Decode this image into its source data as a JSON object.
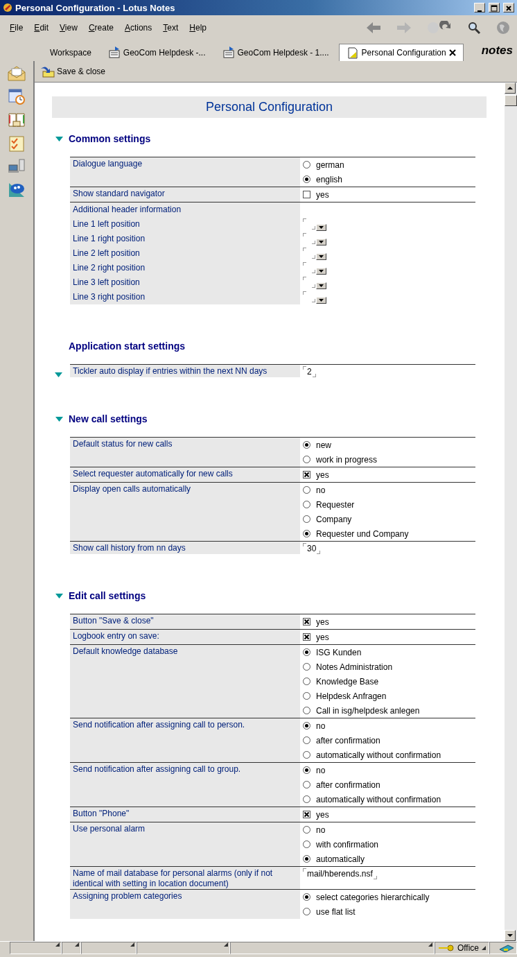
{
  "window": {
    "title": "Personal Configuration - Lotus Notes"
  },
  "menu": [
    "File",
    "Edit",
    "View",
    "Create",
    "Actions",
    "Text",
    "Help"
  ],
  "tabs": [
    {
      "label": "Workspace",
      "selected": false,
      "kind": "plain"
    },
    {
      "label": "GeoCom Helpdesk -...",
      "selected": false,
      "kind": "db"
    },
    {
      "label": "GeoCom Helpdesk -  1....",
      "selected": false,
      "kind": "db"
    },
    {
      "label": "Personal Configuration",
      "selected": true,
      "kind": "doc"
    }
  ],
  "brand": "notes",
  "toolbar": {
    "button": "Save & close"
  },
  "form": {
    "heading": "Personal Configuration",
    "sections": [
      {
        "title": "Common settings",
        "kind": "twistie",
        "rows": [
          {
            "label": "Dialogue language",
            "kind": "radio",
            "options": [
              {
                "label": "german",
                "selected": false
              },
              {
                "label": "english",
                "selected": true
              }
            ]
          },
          {
            "label": "Show standard navigator",
            "kind": "checkbox",
            "options": [
              {
                "label": "yes",
                "checked": false
              }
            ]
          },
          {
            "label": "Additional header information",
            "kind": "label"
          },
          {
            "label": "Line 1 left position",
            "kind": "dropdown"
          },
          {
            "label": "Line 1 right position",
            "kind": "dropdown"
          },
          {
            "label": "Line 2 left position",
            "kind": "dropdown"
          },
          {
            "label": "Line 2 right position",
            "kind": "dropdown"
          },
          {
            "label": "Line 3 left position",
            "kind": "dropdown"
          },
          {
            "label": "Line 3 right position",
            "kind": "dropdown"
          }
        ]
      },
      {
        "title": "Application start settings",
        "kind": "row-twistie",
        "rows": [
          {
            "label": "Tickler auto display if entries within the next NN days",
            "kind": "text",
            "value": "2"
          }
        ]
      },
      {
        "title": "New call settings",
        "kind": "twistie",
        "rows": [
          {
            "label": "Default status for new calls",
            "kind": "radio",
            "options": [
              {
                "label": "new",
                "selected": true
              },
              {
                "label": "work in progress",
                "selected": false
              }
            ]
          },
          {
            "label": "Select requester automatically for new calls",
            "kind": "checkbox",
            "options": [
              {
                "label": "yes",
                "checked": true
              }
            ]
          },
          {
            "label": "Display open calls automatically",
            "kind": "radio",
            "options": [
              {
                "label": "no",
                "selected": false
              },
              {
                "label": "Requester",
                "selected": false
              },
              {
                "label": "Company",
                "selected": false
              },
              {
                "label": "Requester und Company",
                "selected": true
              }
            ]
          },
          {
            "label": "Show call history from nn days",
            "kind": "text",
            "value": "30"
          }
        ]
      },
      {
        "title": "Edit call settings",
        "kind": "twistie",
        "rows": [
          {
            "label": "Button \"Save & close\"",
            "kind": "checkbox",
            "options": [
              {
                "label": "yes",
                "checked": true
              }
            ]
          },
          {
            "label": "Logbook entry on save:",
            "kind": "checkbox",
            "options": [
              {
                "label": "yes",
                "checked": true
              }
            ]
          },
          {
            "label": "Default knowledge database",
            "kind": "radio",
            "options": [
              {
                "label": "ISG Kunden",
                "selected": true
              },
              {
                "label": "Notes Administration",
                "selected": false
              },
              {
                "label": "Knowledge Base",
                "selected": false
              },
              {
                "label": "Helpdesk Anfragen",
                "selected": false
              },
              {
                "label": "Call in isg/helpdesk anlegen",
                "selected": false
              }
            ]
          },
          {
            "label": "Send notification after assigning call to person.",
            "kind": "radio",
            "options": [
              {
                "label": "no",
                "selected": true
              },
              {
                "label": "after confirmation",
                "selected": false
              },
              {
                "label": "automatically without confirmation",
                "selected": false
              }
            ]
          },
          {
            "label": "Send notification after assigning call to group.",
            "kind": "radio",
            "options": [
              {
                "label": "no",
                "selected": true
              },
              {
                "label": "after confirmation",
                "selected": false
              },
              {
                "label": "automatically without confirmation",
                "selected": false
              }
            ]
          },
          {
            "label": "Button \"Phone\"",
            "kind": "checkbox",
            "options": [
              {
                "label": "yes",
                "checked": true
              }
            ]
          },
          {
            "label": "Use personal alarm",
            "kind": "radio",
            "options": [
              {
                "label": "no",
                "selected": false
              },
              {
                "label": "with confirmation",
                "selected": false
              },
              {
                "label": "automatically",
                "selected": true
              }
            ]
          },
          {
            "label": "Name of mail database for personal alarms (only if not identical with setting in location document)",
            "kind": "text",
            "value": "mail/hberends.nsf"
          },
          {
            "label": "Assigning problem categories",
            "kind": "radio",
            "options": [
              {
                "label": "select categories hierarchically",
                "selected": true
              },
              {
                "label": "use flat list",
                "selected": false
              }
            ]
          }
        ]
      }
    ]
  },
  "status_bar": {
    "location": "Office"
  }
}
